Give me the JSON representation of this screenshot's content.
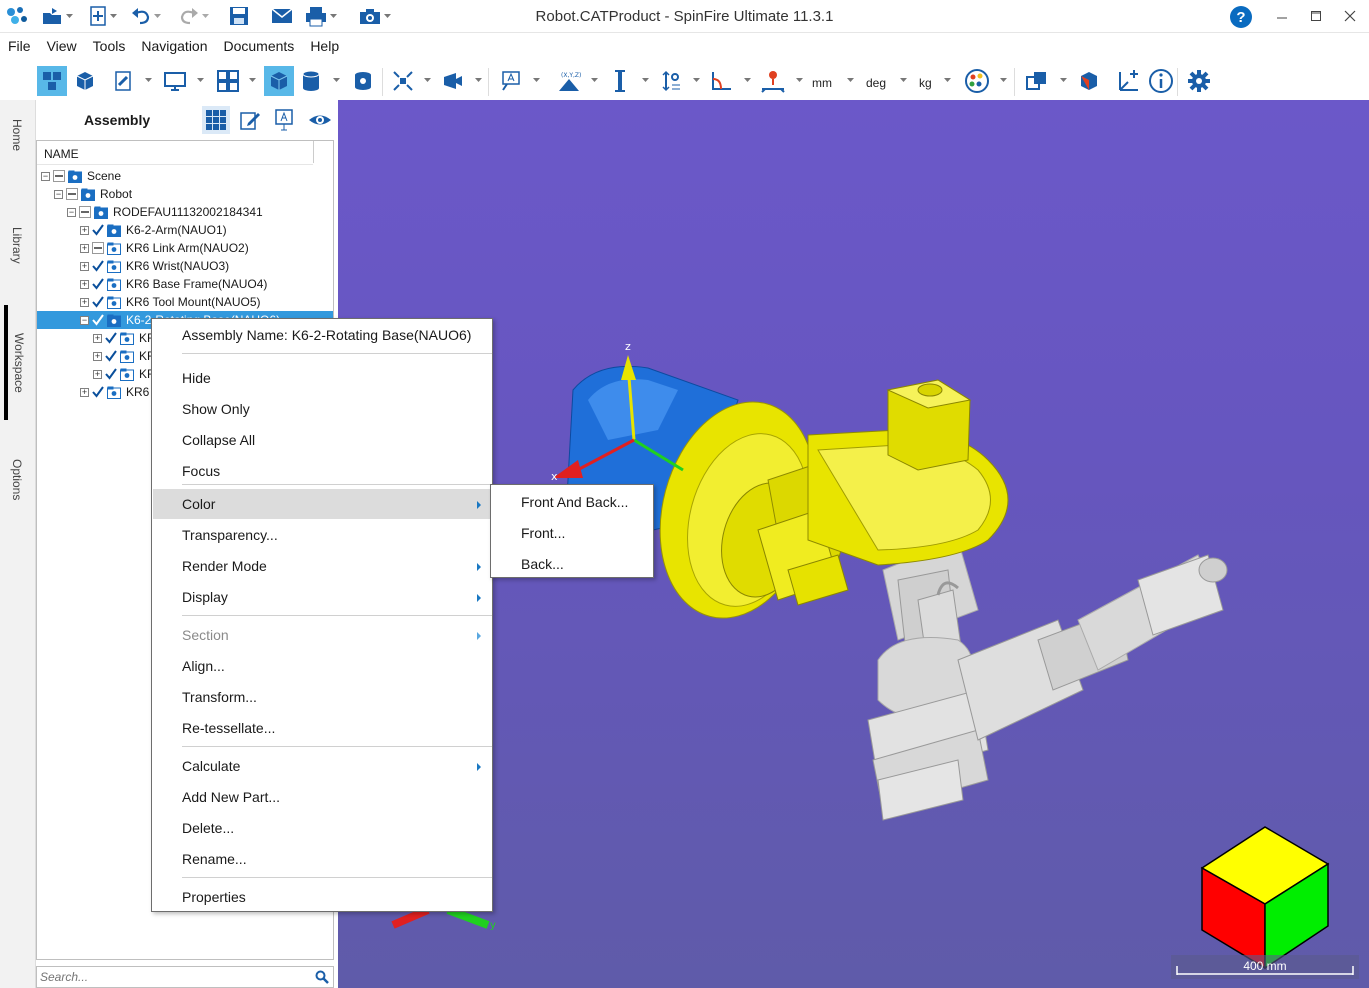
{
  "window": {
    "title": "Robot.CATProduct - SpinFire Ultimate 11.3.1",
    "help": "?"
  },
  "menu": [
    "File",
    "View",
    "Tools",
    "Navigation",
    "Documents",
    "Help"
  ],
  "toolbar": {
    "units": {
      "length": "mm",
      "angle": "deg",
      "mass": "kg"
    }
  },
  "side_tabs": [
    "Home",
    "Library",
    "Workspace",
    "Options"
  ],
  "assembly": {
    "title": "Assembly",
    "column_header": "NAME",
    "search_placeholder": "Search...",
    "tree": [
      {
        "label": "Scene",
        "depth": 0,
        "expander": "−",
        "check": "partial",
        "selected": false
      },
      {
        "label": "Robot",
        "depth": 1,
        "expander": "−",
        "check": "partial",
        "selected": false
      },
      {
        "label": "RODEFAU11132002184341",
        "depth": 2,
        "expander": "−",
        "check": "partial",
        "selected": false
      },
      {
        "label": "K6-2-Arm(NAUO1)",
        "depth": 3,
        "expander": "+",
        "check": "checked",
        "selected": false
      },
      {
        "label": "KR6 Link Arm(NAUO2)",
        "depth": 3,
        "expander": "+",
        "check": "partial",
        "selected": false
      },
      {
        "label": "KR6 Wrist(NAUO3)",
        "depth": 3,
        "expander": "+",
        "check": "checked",
        "selected": false
      },
      {
        "label": "KR6 Base Frame(NAUO4)",
        "depth": 3,
        "expander": "+",
        "check": "checked",
        "selected": false
      },
      {
        "label": "KR6 Tool Mount(NAUO5)",
        "depth": 3,
        "expander": "+",
        "check": "checked",
        "selected": false
      },
      {
        "label": "K6-2-Rotating Base(NAUO6)",
        "depth": 3,
        "expander": "−",
        "check": "checked",
        "selected": true
      },
      {
        "label": "KR",
        "depth": 4,
        "expander": "+",
        "check": "checked",
        "selected": false
      },
      {
        "label": "KR",
        "depth": 4,
        "expander": "+",
        "check": "checked",
        "selected": false
      },
      {
        "label": "KR",
        "depth": 4,
        "expander": "+",
        "check": "checked",
        "selected": false
      },
      {
        "label": "KR6",
        "depth": 3,
        "expander": "+",
        "check": "checked",
        "selected": false
      }
    ]
  },
  "context_menu": {
    "header": "Assembly Name: K6-2-Rotating Base(NAUO6)",
    "items": [
      {
        "label": "Hide"
      },
      {
        "label": "Show Only"
      },
      {
        "label": "Collapse All"
      },
      {
        "label": "Focus"
      },
      {
        "label": "Color",
        "submenu": true,
        "highlight": true
      },
      {
        "label": "Transparency..."
      },
      {
        "label": "Render Mode",
        "submenu": true
      },
      {
        "label": "Display",
        "submenu": true
      },
      {
        "label": "Section",
        "submenu": true,
        "disabled": true
      },
      {
        "label": "Align..."
      },
      {
        "label": "Transform..."
      },
      {
        "label": "Re-tessellate..."
      },
      {
        "label": "Calculate",
        "submenu": true
      },
      {
        "label": "Add New Part..."
      },
      {
        "label": "Delete..."
      },
      {
        "label": "Rename..."
      },
      {
        "label": "Properties"
      }
    ]
  },
  "color_submenu": [
    "Front And Back...",
    "Front...",
    "Back..."
  ],
  "viewport": {
    "axis_labels": {
      "x": "x",
      "y": "y",
      "z": "z"
    },
    "scale_label": "400 mm",
    "colors": {
      "highlight_part": "#e8e400",
      "blue_part": "#1e6ed8",
      "grey_part": "#d8d8d8"
    }
  }
}
